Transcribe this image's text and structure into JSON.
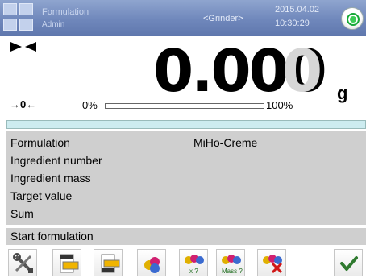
{
  "header": {
    "user_label": "Formulation",
    "user_sub": "Admin",
    "mode_label": "<Grinder>",
    "date": "2015.04.02",
    "time": "10:30:29"
  },
  "display": {
    "value": "0.000",
    "last_digit": "0",
    "unit": "g",
    "zero_indicator": "→0←",
    "range_min": "0%",
    "range_max": "100%",
    "range_fill_fraction": 0
  },
  "info": {
    "rows": [
      {
        "label": "Formulation",
        "value": "MiHo-Creme"
      },
      {
        "label": "Ingredient number",
        "value": ""
      },
      {
        "label": "Ingredient mass",
        "value": ""
      },
      {
        "label": "Target value",
        "value": ""
      },
      {
        "label": "Sum",
        "value": ""
      }
    ],
    "action": "Start formulation"
  },
  "toolbar": {
    "icons": [
      "tools-icon",
      "print-header-icon",
      "print-footer-icon",
      "ingredients-icon",
      "formulation-count-icon",
      "formulation-mass-icon",
      "cancel-formulation-icon",
      "confirm-icon"
    ],
    "labels": {
      "count": "x ?",
      "mass": "Mass ?"
    }
  },
  "colors": {
    "header_gradient": "#7088bc",
    "info_bg": "#cfcfcf",
    "progress_strip": "#cdecf0",
    "confirm": "#2f7a2f",
    "cancel": "#d01818"
  }
}
